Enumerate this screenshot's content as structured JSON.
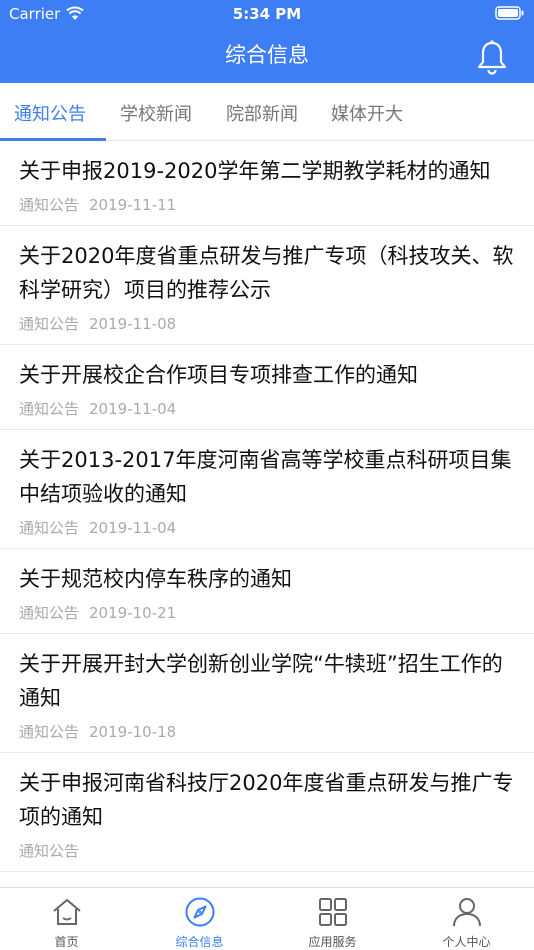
{
  "status_bar": {
    "carrier": "Carrier",
    "time": "5:34 PM"
  },
  "nav": {
    "title": "综合信息",
    "bell_icon": "bell-icon"
  },
  "tabs": [
    {
      "label": "通知公告",
      "active": true
    },
    {
      "label": "学校新闻",
      "active": false
    },
    {
      "label": "院部新闻",
      "active": false
    },
    {
      "label": "媒体开大",
      "active": false
    }
  ],
  "list": [
    {
      "title": "关于申报2019-2020学年第二学期教学耗材的通知",
      "category": "通知公告",
      "date": "2019-11-11"
    },
    {
      "title": "关于2020年度省重点研发与推广专项（科技攻关、软科学研究）项目的推荐公示",
      "category": "通知公告",
      "date": "2019-11-08"
    },
    {
      "title": "关于开展校企合作项目专项排查工作的通知",
      "category": "通知公告",
      "date": "2019-11-04"
    },
    {
      "title": "关于2013-2017年度河南省高等学校重点科研项目集中结项验收的通知",
      "category": "通知公告",
      "date": "2019-11-04"
    },
    {
      "title": "关于规范校内停车秩序的通知",
      "category": "通知公告",
      "date": "2019-10-21"
    },
    {
      "title": "关于开展开封大学创新创业学院“牛犊班”招生工作的通知",
      "category": "通知公告",
      "date": "2019-10-18"
    },
    {
      "title": "关于申报河南省科技厅2020年度省重点研发与推广专项的通知",
      "category": "通知公告",
      "date": ""
    }
  ],
  "tabbar": [
    {
      "label": "首页",
      "icon": "home-icon",
      "active": false
    },
    {
      "label": "综合信息",
      "icon": "compass-icon",
      "active": true
    },
    {
      "label": "应用服务",
      "icon": "grid-icon",
      "active": false
    },
    {
      "label": "个人中心",
      "icon": "user-icon",
      "active": false
    }
  ],
  "colors": {
    "accent": "#3d7ef5",
    "muted_text": "#aaaaaa"
  }
}
